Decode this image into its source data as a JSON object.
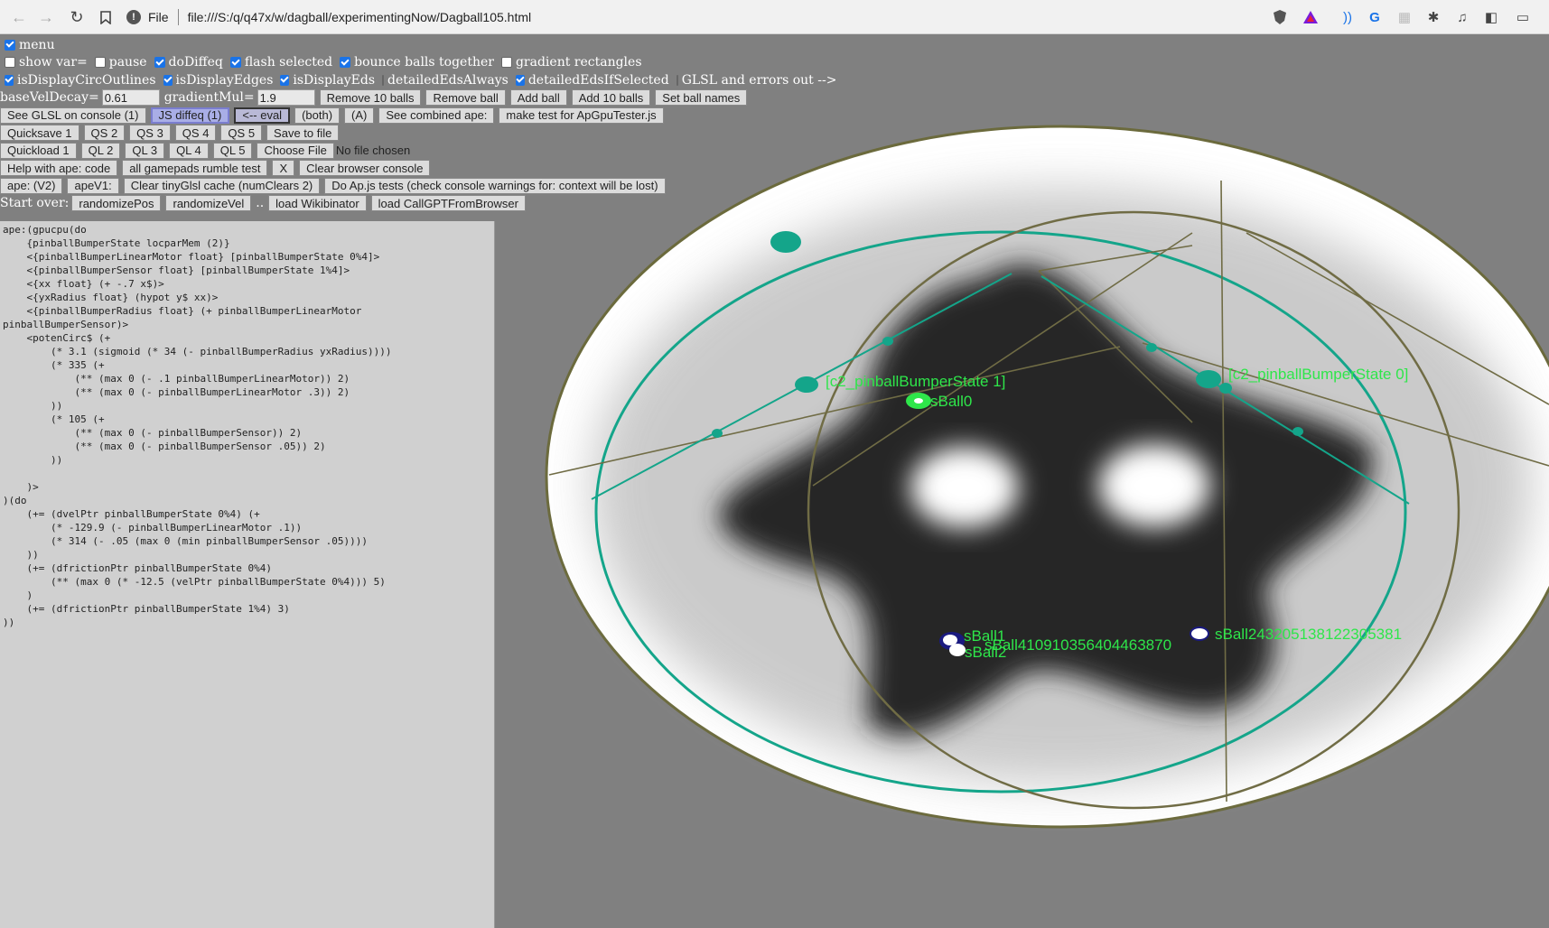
{
  "browser": {
    "url_prefix": "File",
    "url": "file:///S:/q/q47x/w/dagball/experimentingNow/Dagball105.html"
  },
  "controls": {
    "row1": {
      "menu": "menu"
    },
    "row2": {
      "show_var": "show var=",
      "pause": "pause",
      "doDiffeq": "doDiffeq",
      "flash_selected": "flash selected",
      "bounce": "bounce balls together",
      "gradient": "gradient rectangles"
    },
    "row3": {
      "circ": "isDisplayCircOutlines",
      "edges": "isDisplayEdges",
      "eds": "isDisplayEds",
      "detailed_always": "detailedEdsAlways",
      "detailed_if": "detailedEdsIfSelected",
      "glsl": "GLSL and errors out -->"
    },
    "row4": {
      "base_label": "baseVelDecay=",
      "base_value": "0.61",
      "grad_label": "gradientMul=",
      "grad_value": "1.9",
      "remove10": "Remove 10 balls",
      "remove": "Remove ball",
      "add": "Add ball",
      "add10": "Add 10 balls",
      "names": "Set ball names"
    },
    "row5": {
      "glsl_console": "See GLSL on console (1)",
      "js_diffeq": "JS diffeq (1)",
      "eval": "<-- eval",
      "both": "(both)",
      "a": "(A)",
      "combined": "See combined ape:",
      "maketest": "make test for ApGpuTester.js"
    },
    "row6": {
      "qs1": "Quicksave 1",
      "qs2": "QS 2",
      "qs3": "QS 3",
      "qs4": "QS 4",
      "qs5": "QS 5",
      "save": "Save to file"
    },
    "row7": {
      "ql1": "Quickload 1",
      "ql2": "QL 2",
      "ql3": "QL 3",
      "ql4": "QL 4",
      "ql5": "QL 5",
      "choose": "Choose File",
      "nofile": "No file chosen"
    },
    "row8": {
      "help": "Help with ape: code",
      "rumble": "all gamepads rumble test",
      "x": "X",
      "clear": "Clear browser console"
    },
    "row9": {
      "apev2": "ape: (V2)",
      "apev1": "apeV1:",
      "cache": "Clear tinyGlsl cache (numClears 2)",
      "tests": "Do Ap.js tests (check console warnings for: context will be lost)"
    },
    "row10": {
      "startover": "Start over:",
      "rpos": "randomizePos",
      "rvel": "randomizeVel",
      "dots": "..",
      "wiki": "load Wikibinator",
      "gpt": "load CallGPTFromBrowser"
    }
  },
  "code": "ape:(gpucpu(do\n    {pinballBumperState locparMem (2)}\n    <{pinballBumperLinearMotor float} [pinballBumperState 0%4]>\n    <{pinballBumperSensor float} [pinballBumperState 1%4]>\n    <{xx float} (+ -.7 x$)>\n    <{yxRadius float} (hypot y$ xx)>\n    <{pinballBumperRadius float} (+ pinballBumperLinearMotor\npinballBumperSensor)>\n    <potenCirc$ (+\n        (* 3.1 (sigmoid (* 34 (- pinballBumperRadius yxRadius))))\n        (* 335 (+\n            (** (max 0 (- .1 pinballBumperLinearMotor)) 2)\n            (** (max 0 (- pinballBumperLinearMotor .3)) 2)\n        ))\n        (* 105 (+\n            (** (max 0 (- pinballBumperSensor)) 2)\n            (** (max 0 (- pinballBumperSensor .05)) 2)\n        ))\n\n    )>\n)(do\n    (+= (dvelPtr pinballBumperState 0%4) (+\n        (* -129.9 (- pinballBumperLinearMotor .1))\n        (* 314 (- .05 (max 0 (min pinballBumperSensor .05))))\n    ))\n    (+= (dfrictionPtr pinballBumperState 0%4)\n        (** (max 0 (* -12.5 (velPtr pinballBumperState 0%4))) 5)\n    )\n    (+= (dfrictionPtr pinballBumperState 1%4) 3)\n))",
  "sim_labels": {
    "state1": "[c2_pinballBumperState 1]",
    "state0": "[c2_pinballBumperState 0]",
    "ball0": "sBall0",
    "ball1": "sBall1",
    "ball2": "sBall2",
    "ballA": "sBall410910356404463870",
    "ballB": "sBall2432051381223053​81"
  },
  "colors": {
    "teal": "#14a58a",
    "olive": "#706c45",
    "green": "#2ee64a"
  }
}
